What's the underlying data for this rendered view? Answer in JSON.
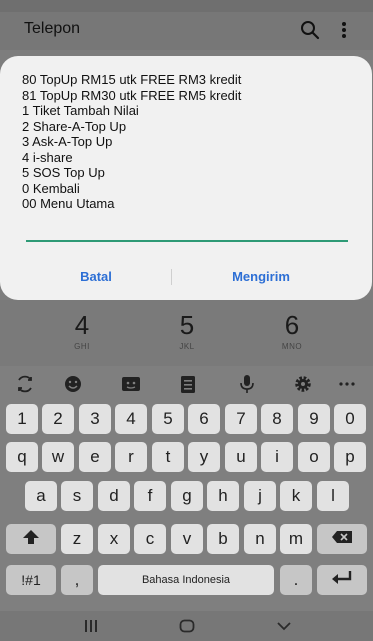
{
  "app": {
    "title": "Telepon"
  },
  "dialog": {
    "lines": [
      "80 TopUp RM15 utk FREE RM3 kredit",
      "81 TopUp RM30 utk FREE RM5 kredit",
      "1 Tiket Tambah Nilai",
      "2 Share-A-Top Up",
      "3 Ask-A-Top Up",
      "4 i-share",
      "5 SOS Top Up",
      "0 Kembali",
      "00 Menu Utama"
    ],
    "input_value": "",
    "cancel_label": "Batal",
    "send_label": "Mengirim",
    "accent_color": "#2d6fd5",
    "input_line_color": "#2e9a76"
  },
  "dialpad": [
    {
      "digit": "4",
      "letters": "GHI"
    },
    {
      "digit": "5",
      "letters": "JKL"
    },
    {
      "digit": "6",
      "letters": "MNO"
    }
  ],
  "keyboard": {
    "toolbar_icons": [
      "translate-icon",
      "emoji-icon",
      "sticker-icon",
      "clipboard-icon",
      "mic-icon",
      "settings-icon",
      "more-icon"
    ],
    "rows": [
      [
        "1",
        "2",
        "3",
        "4",
        "5",
        "6",
        "7",
        "8",
        "9",
        "0"
      ],
      [
        "q",
        "w",
        "e",
        "r",
        "t",
        "y",
        "u",
        "i",
        "o",
        "p"
      ],
      [
        "a",
        "s",
        "d",
        "f",
        "g",
        "h",
        "j",
        "k",
        "l"
      ],
      [
        "z",
        "x",
        "c",
        "v",
        "b",
        "n",
        "m"
      ]
    ],
    "symbols_label": "!#1",
    "comma_label": ",",
    "space_label": "Bahasa Indonesia",
    "period_label": "."
  },
  "navbar": {
    "icons": [
      "recents-icon",
      "home-icon",
      "back-icon"
    ]
  }
}
